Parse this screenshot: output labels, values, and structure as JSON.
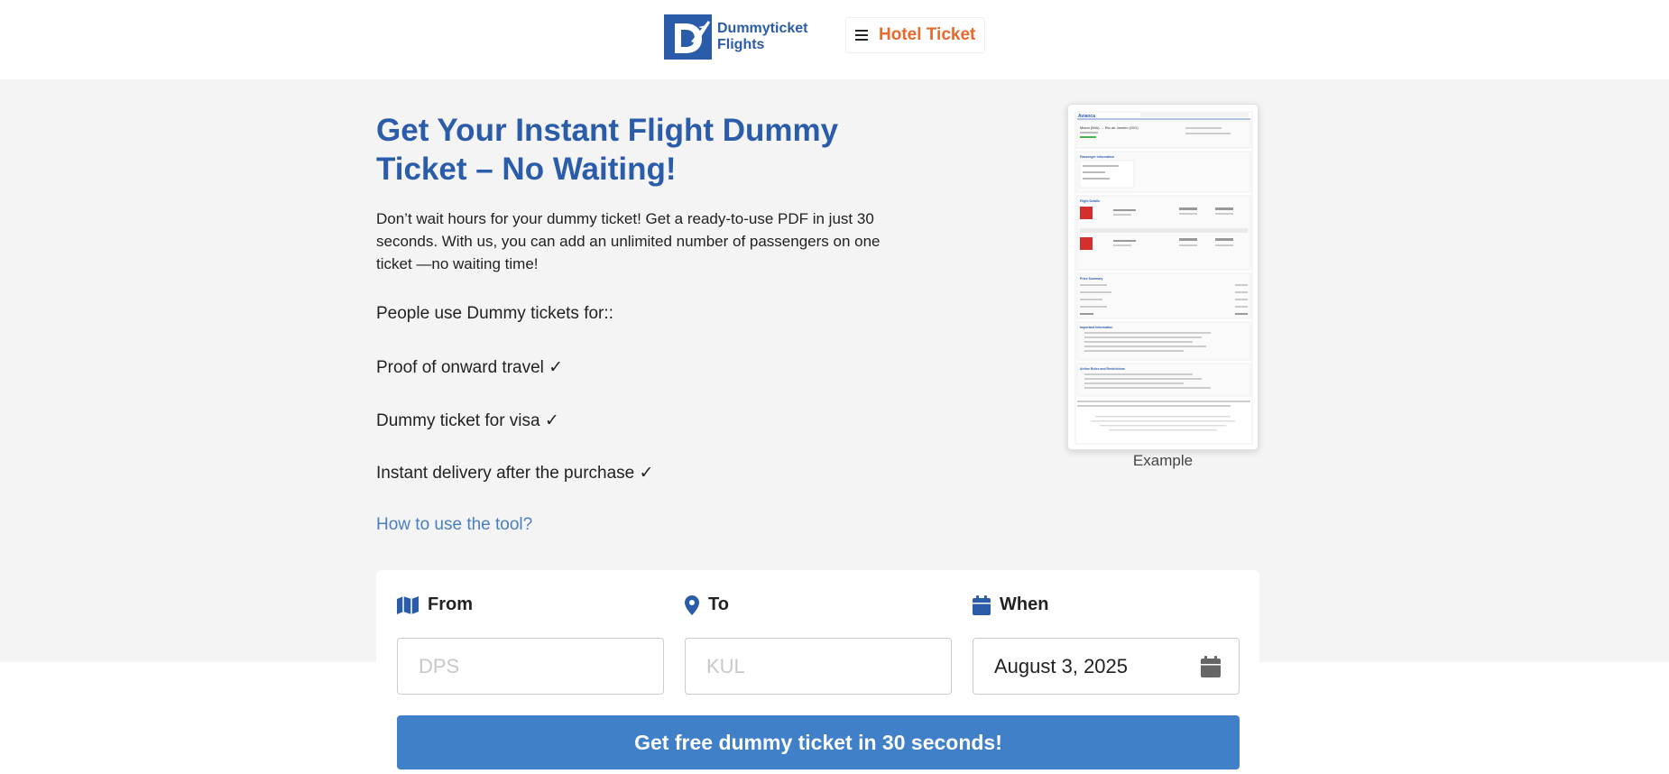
{
  "brand": {
    "logo_text_line1": "Dummyticket",
    "logo_text_line2": "Flights",
    "accent": "#2b5caa"
  },
  "header": {
    "menu_icon": "hamburger-icon",
    "menu_label": "Hotel Ticket"
  },
  "hero": {
    "title": "Get Your Instant Flight Dummy Ticket – No Waiting!",
    "intro": "Don’t wait hours for your dummy ticket! Get a ready-to-use PDF in just 30 seconds. With us, you can add an unlimited number of passengers on one ticket —no waiting time!",
    "uses_heading": "People use Dummy tickets for::",
    "uses": [
      "Proof of onward travel ✓",
      "Dummy ticket for visa ✓",
      "Instant delivery after the purchase  ✓"
    ],
    "howto_link": "How to use the tool?",
    "example_caption": "Example"
  },
  "ticket_preview": {
    "airline": "Avianca",
    "route": "Miami (MIA) → Rio de Janeiro (GIG)",
    "sections": [
      "Passenger Information",
      "Flight Details",
      "Price Summary",
      "Important Information",
      "Airline Rules and Restrictions"
    ]
  },
  "search": {
    "from_label": "From",
    "from_placeholder": "DPS",
    "to_label": "To",
    "to_placeholder": "KUL",
    "when_label": "When",
    "when_value": "August 3, 2025",
    "cta_label": "Get free dummy ticket in 30 seconds!"
  }
}
